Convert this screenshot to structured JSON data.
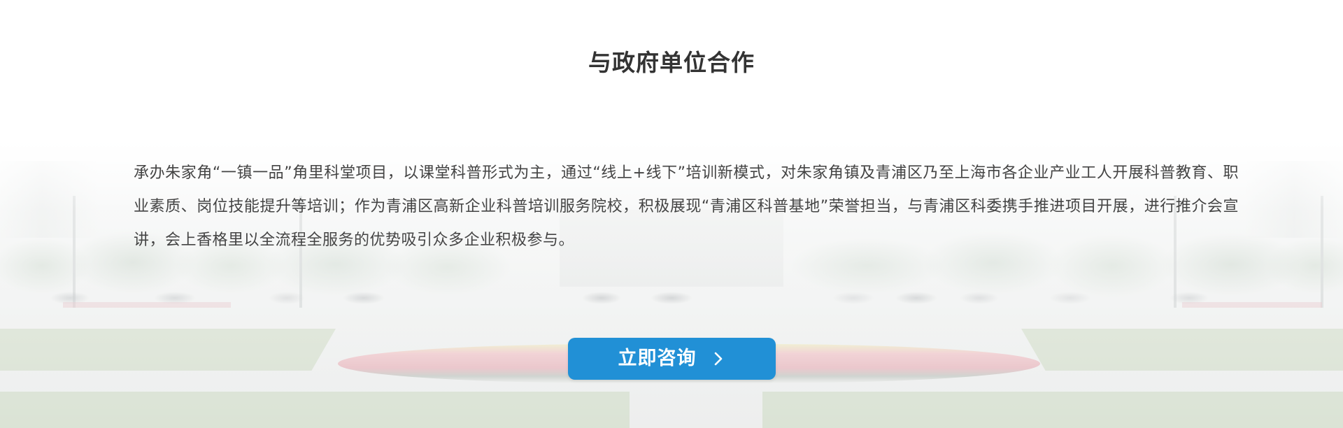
{
  "section": {
    "title": "与政府单位合作",
    "description": "承办朱家角“一镇一品”角里科堂项目，以课堂科普形式为主，通过“线上+线下”培训新模式，对朱家角镇及青浦区乃至上海市各企业产业工人开展科普教育、职业素质、岗位技能提升等培训；作为青浦区高新企业科普培训服务院校，积极展现“青浦区科普基地”荣誉担当，与青浦区科委携手推进项目开展，进行推介会宣讲，会上香格里以全流程全服务的优势吸引众多企业积极参与。"
  },
  "cta": {
    "label": "立即咨询",
    "icon": "chevron-right-icon",
    "background_color": "#2190d6",
    "text_color": "#ffffff"
  },
  "colors": {
    "title": "#333333",
    "body_text": "#444444",
    "page_background": "#ffffff"
  }
}
